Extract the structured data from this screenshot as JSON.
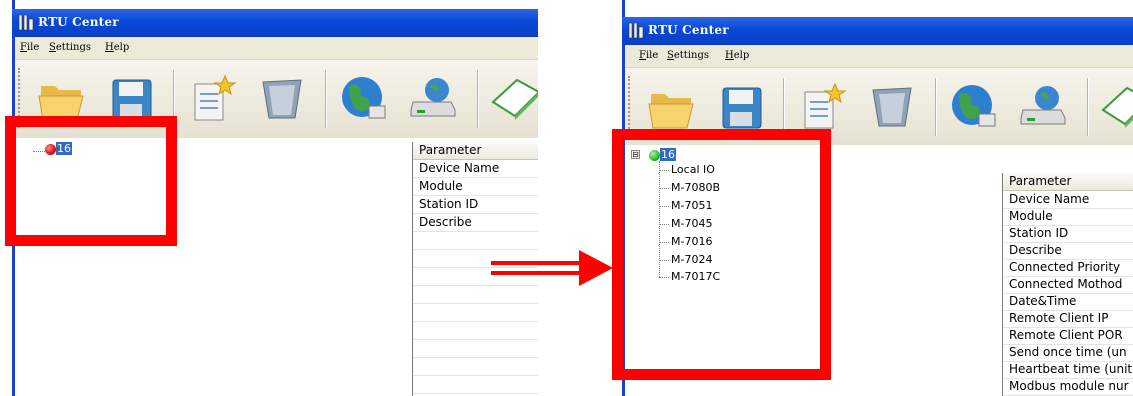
{
  "left_window": {
    "title": "RTU Center",
    "menu": [
      {
        "label": "File",
        "underline": "F",
        "rest": "ile"
      },
      {
        "label": "Settings",
        "underline": "S",
        "rest": "ettings"
      },
      {
        "label": "Help",
        "underline": "H",
        "rest": "elp"
      }
    ],
    "toolbar_icons": [
      "open-folder-icon",
      "save-disk-icon",
      "new-document-icon",
      "trash-bin-icon",
      "globe-connect-icon",
      "device-icon",
      "book-icon"
    ],
    "tree_root": {
      "label": "16",
      "status": "disconnected",
      "status_color": "#d81010"
    },
    "param_header": "Parameter",
    "params": [
      "Device Name",
      "Module",
      "Station ID",
      "Describe"
    ]
  },
  "right_window": {
    "title": "RTU Center",
    "menu": [
      {
        "label": "File",
        "underline": "F",
        "rest": "ile"
      },
      {
        "label": "Settings",
        "underline": "S",
        "rest": "ettings"
      },
      {
        "label": "Help",
        "underline": "H",
        "rest": "elp"
      }
    ],
    "tree_root": {
      "label": "16",
      "status": "connected",
      "status_color": "#28b828",
      "expander": "⊟"
    },
    "tree_children": [
      "Local IO",
      "M-7080B",
      "M-7051",
      "M-7045",
      "M-7016",
      "M-7024",
      "M-7017C"
    ],
    "param_header": "Parameter",
    "params": [
      "Device Name",
      "Module",
      "Station ID",
      "Describe",
      "Connected Priority",
      "Connected Mothod",
      "Date&Time",
      "Remote Client IP",
      "Remote Client POR",
      "Send once time (un",
      "Heartbeat time (unit",
      "Modbus module nur"
    ]
  },
  "colors": {
    "highlight": "#ff0000",
    "titlebar": "#0a48d8",
    "selection": "#316ac5"
  }
}
